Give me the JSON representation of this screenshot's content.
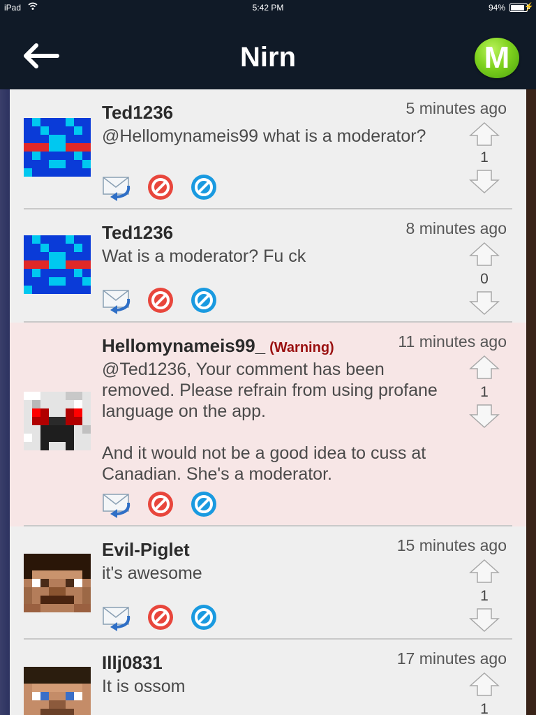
{
  "status": {
    "device": "iPad",
    "time": "5:42 PM",
    "battery": "94%",
    "battery_level": 0.94
  },
  "nav": {
    "title": "Nirn",
    "menu_label": "M"
  },
  "colors": {
    "bar": "#101a27",
    "menu_green": "#7fd21e",
    "warning": "#9a1010",
    "warn_bg": "#f7e6e6"
  },
  "comments": [
    {
      "user": "Ted1236",
      "time": "5 minutes ago",
      "text": "@Hellomynameis99 what is a moderator?",
      "score": "1",
      "avatar": "blue-creeper-avatar"
    },
    {
      "user": "Ted1236",
      "time": "8 minutes ago",
      "text": "Wat is a moderator? Fu ck",
      "score": "0",
      "avatar": "blue-creeper-avatar"
    },
    {
      "user": "Hellomynameis99_",
      "warning": "(Warning)",
      "time": "11 minutes ago",
      "text": "@Ted1236, Your comment has been removed. Please refrain from using profane language on the app.\n\nAnd it would not be a good idea to cuss at Canadian. She's a moderator.",
      "score": "1",
      "avatar": "white-creeper-avatar"
    },
    {
      "user": "Evil-Piglet",
      "time": "15 minutes ago",
      "text": "it's awesome",
      "score": "1",
      "avatar": "brown-skin-avatar"
    },
    {
      "user": "Illj0831",
      "time": "17 minutes ago",
      "text": "It is ossom",
      "score": "1",
      "avatar": "steve-avatar"
    }
  ],
  "icons": {
    "reply": "reply-mail-icon",
    "report": "report-icon",
    "block": "block-icon",
    "upvote": "upvote-arrow-icon",
    "downvote": "downvote-arrow-icon",
    "back": "back-arrow-icon"
  }
}
